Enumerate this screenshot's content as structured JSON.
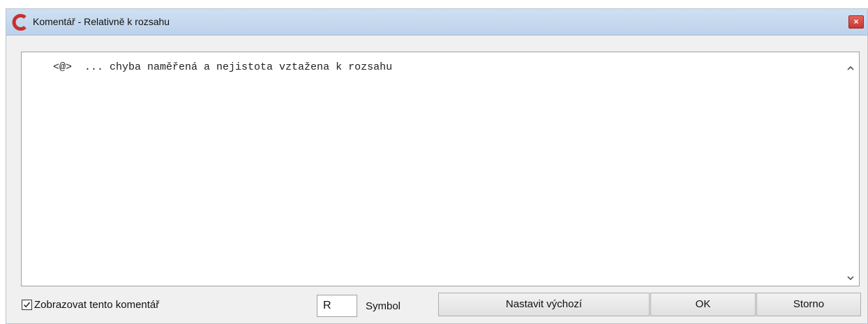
{
  "window": {
    "title": "Komentář - Relativně k rozsahu",
    "close_label": "×",
    "accent_color": "#c7372e",
    "titlebar_color": "#c6daf0"
  },
  "editor": {
    "text": "<@>  ... chyba naměřená a nejistota vztažena k rozsahu"
  },
  "footer": {
    "show_comment_label": "Zobrazovat tento komentář",
    "show_comment_checked": true,
    "symbol_value": "R",
    "symbol_label": "Symbol",
    "set_default_label": "Nastavit výchozí",
    "ok_label": "OK",
    "cancel_label": "Storno"
  },
  "icons": {
    "app": "app-logo-icon",
    "close": "close-icon",
    "scroll_up": "chevron-up-icon",
    "scroll_down": "chevron-down-icon",
    "check": "checkmark-icon"
  }
}
